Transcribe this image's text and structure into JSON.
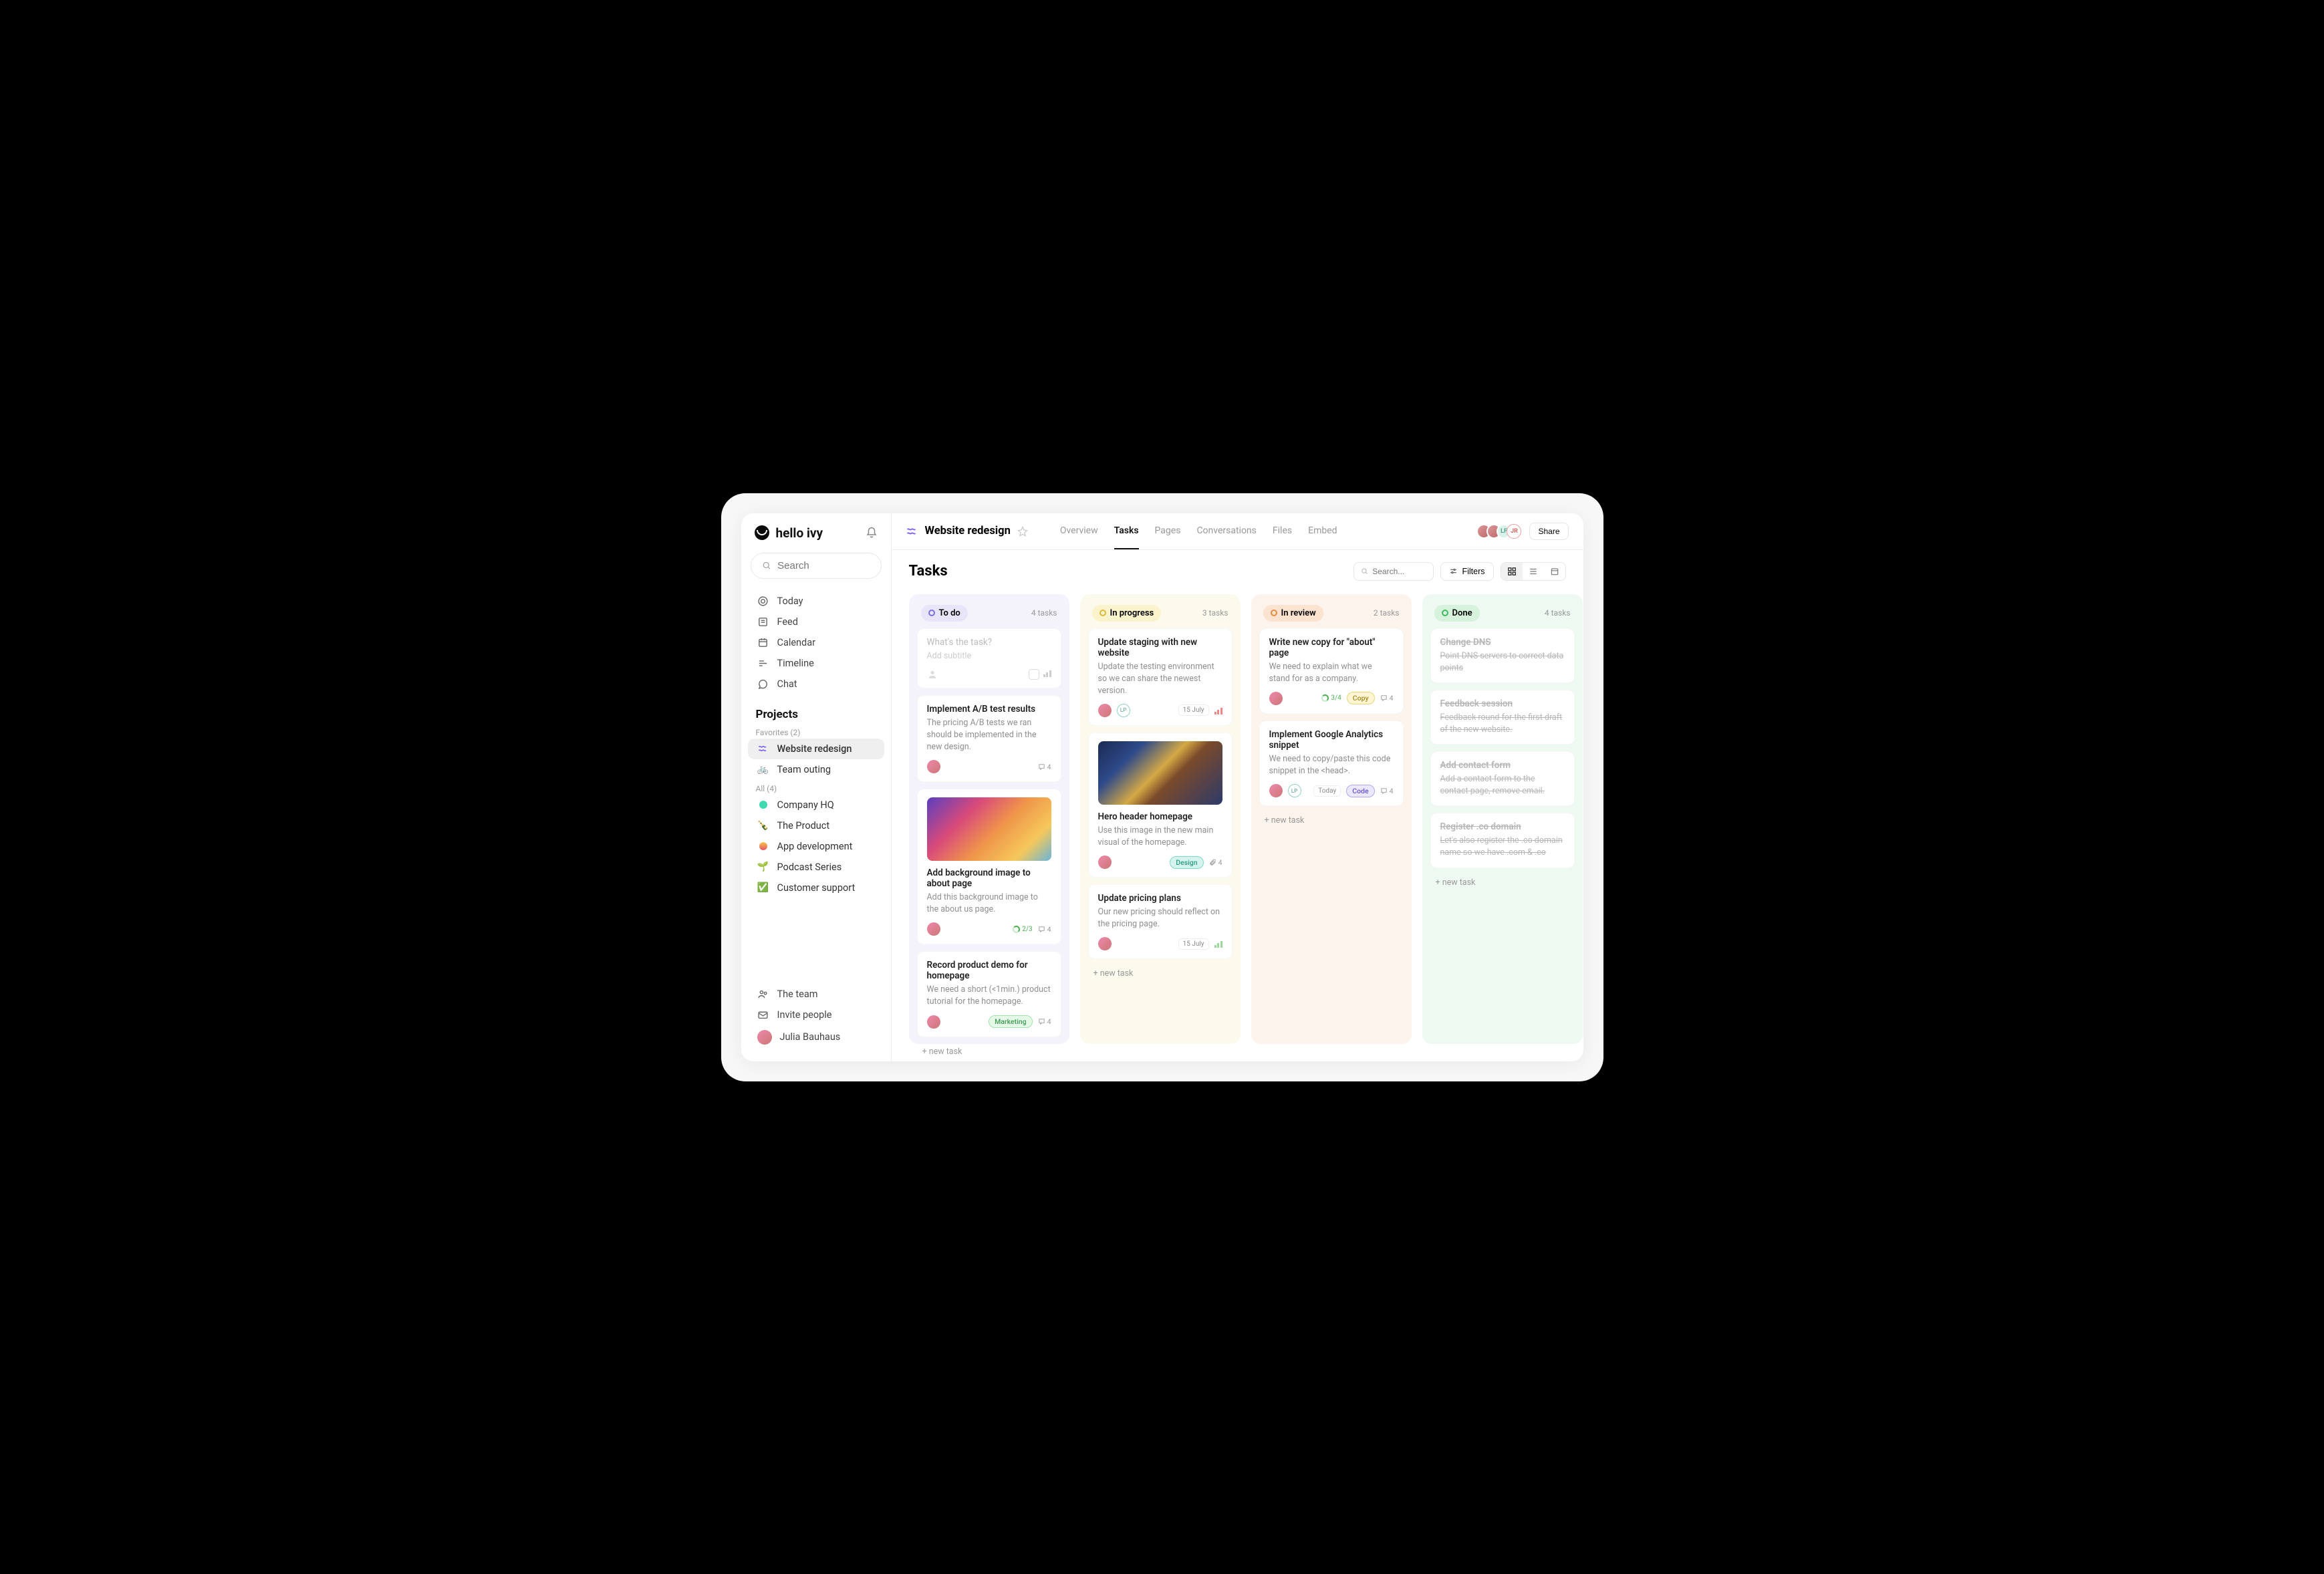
{
  "brand": "hello ivy",
  "search_placeholder": "Search",
  "nav": [
    {
      "icon": "target",
      "label": "Today"
    },
    {
      "icon": "feed",
      "label": "Feed"
    },
    {
      "icon": "calendar",
      "label": "Calendar"
    },
    {
      "icon": "timeline",
      "label": "Timeline"
    },
    {
      "icon": "chat",
      "label": "Chat"
    }
  ],
  "projects": {
    "title": "Projects",
    "fav_label": "Favorites (2)",
    "favorites": [
      {
        "icon": "wave",
        "label": "Website redesign",
        "active": true
      },
      {
        "icon": "bike",
        "label": "Team outing"
      }
    ],
    "all_label": "All (4)",
    "all": [
      {
        "icon": "dot-teal",
        "label": "Company HQ"
      },
      {
        "icon": "bottle",
        "label": "The Product"
      },
      {
        "icon": "dot-sunset",
        "label": "App development"
      },
      {
        "icon": "seedling",
        "label": "Podcast Series"
      },
      {
        "icon": "check",
        "label": "Customer support"
      }
    ]
  },
  "sidebar_bottom": [
    {
      "icon": "team",
      "label": "The team"
    },
    {
      "icon": "invite",
      "label": "Invite people"
    }
  ],
  "user_name": "Julia Bauhaus",
  "header": {
    "project": "Website redesign",
    "tabs": [
      "Overview",
      "Tasks",
      "Pages",
      "Conversations",
      "Files",
      "Embed"
    ],
    "active_tab": "Tasks",
    "avatars": [
      {
        "type": "img"
      },
      {
        "type": "img"
      },
      {
        "type": "txt",
        "txt": "LP",
        "bg": "#d9f2ea",
        "fg": "#4a9a87"
      },
      {
        "type": "txt",
        "txt": "JR",
        "bg": "#fff",
        "fg": "#d25a5a",
        "border": "#e8a0a0"
      }
    ],
    "share": "Share"
  },
  "subbar": {
    "title": "Tasks",
    "search_placeholder": "Search...",
    "filters": "Filters"
  },
  "columns": [
    {
      "key": "todo",
      "title": "To do",
      "count": "4 tasks",
      "new_input": {
        "placeholder": "What's the task?",
        "sub": "Add subtitle"
      },
      "cards": [
        {
          "title": "Implement A/B test results",
          "desc": "The pricing A/B tests we ran should be implemented in the new design.",
          "avatar": true,
          "comments": "4"
        },
        {
          "cover": "wave",
          "title": "Add background image to about page",
          "desc": "Add this background image to the about us page.",
          "avatar": true,
          "progress": "2/3",
          "comments": "4"
        },
        {
          "title": "Record product demo for homepage",
          "desc": "We need a short (<1min.) product tutorial for the homepage.",
          "avatar": true,
          "tag": {
            "text": "Marketing",
            "cls": "green"
          },
          "comments": "4"
        }
      ],
      "new_task": "+ new task"
    },
    {
      "key": "progress",
      "title": "In progress",
      "count": "3 tasks",
      "cards": [
        {
          "title": "Update staging with new website",
          "desc": "Update the testing environment so we can share the newest version.",
          "avatar": true,
          "lp": true,
          "date": "15 July",
          "bars": "high"
        },
        {
          "cover": "vg",
          "title": "Hero header homepage",
          "desc": "Use this image in the new main visual of the homepage.",
          "avatar": true,
          "tag": {
            "text": "Design",
            "cls": "teal"
          },
          "attach": "4"
        },
        {
          "title": "Update pricing plans",
          "desc": "Our new pricing should reflect on the pricing page.",
          "avatar": true,
          "date": "15 July",
          "bars": "low"
        }
      ],
      "new_task": "+ new task"
    },
    {
      "key": "review",
      "title": "In review",
      "count": "2 tasks",
      "cards": [
        {
          "title": "Write new copy for \"about\" page",
          "desc": "We need to explain what we stand for as a company.",
          "avatar": true,
          "progress": "3/4",
          "tag": {
            "text": "Copy",
            "cls": "yellow"
          },
          "comments": "4"
        },
        {
          "title": "Implement Google Analytics snippet",
          "desc": "We need to copy/paste this code snippet in the <head>.",
          "avatar": true,
          "lp": true,
          "date": "Today",
          "tag": {
            "text": "Code",
            "cls": "purple"
          },
          "comments": "4"
        }
      ],
      "new_task": "+ new task"
    },
    {
      "key": "done",
      "title": "Done",
      "count": "4 tasks",
      "cards": [
        {
          "strike": true,
          "title": "Change DNS",
          "desc": "Point DNS servers to correct data points"
        },
        {
          "strike": true,
          "title": "Feedback session",
          "desc": "Feedback round for the first draft of the new website."
        },
        {
          "strike": true,
          "title": "Add contact form",
          "desc": "Add a contact form to the contact page, remove email."
        },
        {
          "strike": true,
          "title": "Register .co domain",
          "desc": "Let's also register the .co domain name so we have .com & .co"
        }
      ],
      "new_task": "+ new task"
    }
  ]
}
